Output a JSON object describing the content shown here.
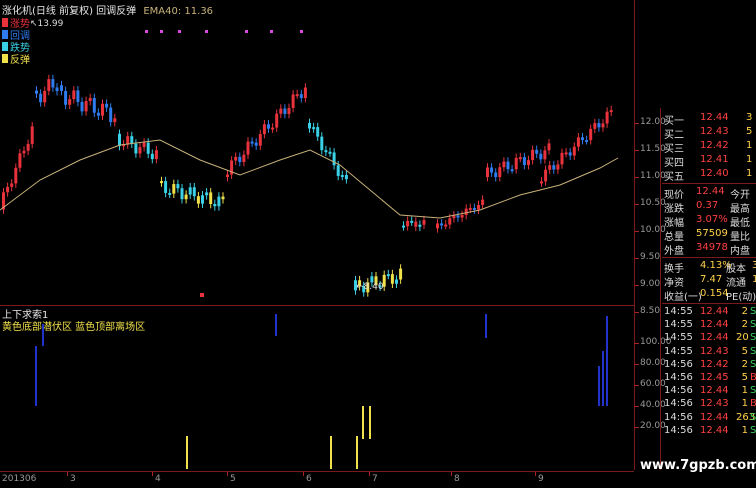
{
  "header": {
    "title": "涨化机(日线 前复权) 回调反弹",
    "ema_label": "EMA40: 11.36",
    "high_marker": "13.99",
    "low_marker": "8.40"
  },
  "legend": [
    {
      "label": "涨势",
      "color": "#e8323c"
    },
    {
      "label": "回调",
      "color": "#2f7cf0"
    },
    {
      "label": "跌势",
      "color": "#3ad0e6"
    },
    {
      "label": "反弹",
      "color": "#f0e04a"
    }
  ],
  "price_axis": [
    "12.00",
    "11.50",
    "11.00",
    "10.50",
    "10.00",
    "9.50",
    "9.00",
    "8.50"
  ],
  "indicator": {
    "title": "上下求索1",
    "subtitle": "黄色底部潜伏区 蓝色顶部离场区",
    "axis": [
      "100.00",
      "80.00",
      "60.00",
      "40.00",
      "20.00"
    ]
  },
  "dates": [
    "201306",
    "3",
    "4",
    "5",
    "6",
    "7",
    "8",
    "9"
  ],
  "quote": {
    "bids": [
      {
        "label": "买一",
        "price": "12.44",
        "vol": "3"
      },
      {
        "label": "买二",
        "price": "12.43",
        "vol": "5"
      },
      {
        "label": "买三",
        "price": "12.42",
        "vol": "1"
      },
      {
        "label": "买四",
        "price": "12.41",
        "vol": "1"
      },
      {
        "label": "买五",
        "price": "12.40",
        "vol": "1"
      }
    ],
    "stats": [
      {
        "label": "现价",
        "value": "12.44",
        "label2": "今开"
      },
      {
        "label": "涨跌",
        "value": "0.37",
        "label2": "最高"
      },
      {
        "label": "涨幅",
        "value": "3.07%",
        "label2": "最低"
      },
      {
        "label": "总量",
        "value": "57509",
        "label2": "量比"
      },
      {
        "label": "外盘",
        "value": "34978",
        "label2": "内盘"
      }
    ],
    "stats2": [
      {
        "label": "换手",
        "value": "4.13%",
        "label2": "股本",
        "v2": "3"
      },
      {
        "label": "净资",
        "value": "7.47",
        "label2": "流通",
        "v2": "1"
      },
      {
        "label": "收益(一)",
        "value": "0.154",
        "label2": "PE(动)",
        "v2": ""
      }
    ],
    "trades": [
      {
        "time": "14:55",
        "price": "12.44",
        "vol": "2",
        "flag": "S"
      },
      {
        "time": "14:55",
        "price": "12.44",
        "vol": "2",
        "flag": "S"
      },
      {
        "time": "14:55",
        "price": "12.44",
        "vol": "20",
        "flag": "S"
      },
      {
        "time": "14:55",
        "price": "12.43",
        "vol": "5",
        "flag": "S"
      },
      {
        "time": "14:56",
        "price": "12.42",
        "vol": "2",
        "flag": "S"
      },
      {
        "time": "14:56",
        "price": "12.45",
        "vol": "5",
        "flag": "B"
      },
      {
        "time": "14:56",
        "price": "12.44",
        "vol": "1",
        "flag": "S"
      },
      {
        "time": "14:56",
        "price": "12.43",
        "vol": "1",
        "flag": "B"
      },
      {
        "time": "14:56",
        "price": "12.44",
        "vol": "263",
        "flag": "S"
      },
      {
        "time": "14:56",
        "price": "12.44",
        "vol": "1",
        "flag": "S"
      }
    ]
  },
  "watermark": "www.7gpzb.com",
  "colors": {
    "up": "#e8323c",
    "down": "#3ad0e6",
    "pullback": "#2f7cf0",
    "rebound": "#f0e04a",
    "ema": "#c8b27a"
  }
}
